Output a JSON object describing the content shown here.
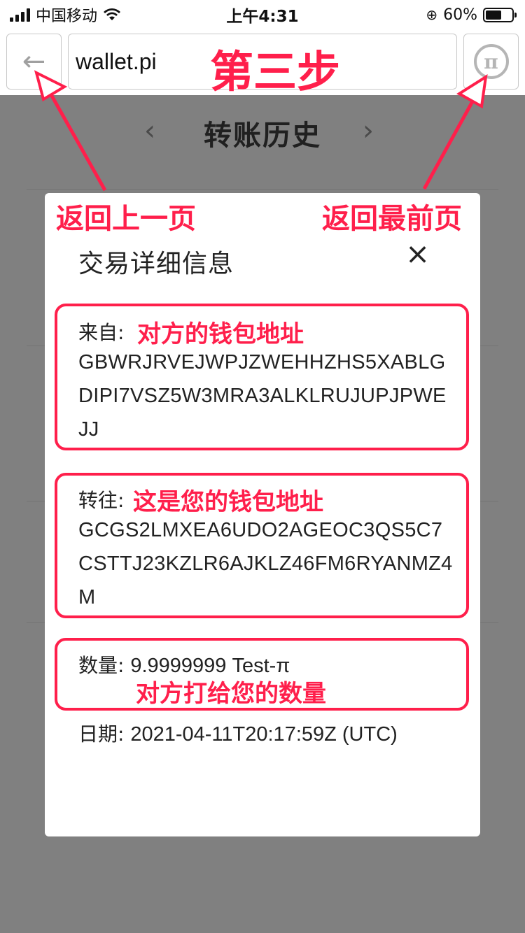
{
  "status_bar": {
    "carrier": "中国移动",
    "time": "上午4:31",
    "battery": "60%",
    "battery_level": 0.6
  },
  "address_bar": {
    "back_icon": "arrow-left-icon",
    "url": "wallet.pi",
    "home_icon": "pi-logo-icon",
    "pi_symbol": "π"
  },
  "page": {
    "title": "转账历史",
    "prev": "‹",
    "next": "›"
  },
  "modal": {
    "title": "交易详细信息",
    "close": "×",
    "from_label": "来自:",
    "from_address": "GBWRJRVEJWPJZWEHHZHS5XABLGDIPI7VSZ5W3MRA3ALKLRUJUPJPWEJJ",
    "to_label": "转往:",
    "to_address": "GCGS2LMXEA6UDO2AGEOC3QS5C7CSTTJ23KZLR6AJKLZ46FM6RYANMZ4M",
    "amount_label": "数量:",
    "amount_value": "9.9999999 Test-π",
    "date_label": "日期:",
    "date_value": "2021-04-11T20:17:59Z (UTC)"
  },
  "annotations": {
    "step": "第三步",
    "back_hint": "返回上一页",
    "home_hint": "返回最前页",
    "from_hint": "对方的钱包地址",
    "to_hint": "这是您的钱包地址",
    "amount_hint": "对方打给您的数量",
    "color": "#ff1f4b"
  }
}
